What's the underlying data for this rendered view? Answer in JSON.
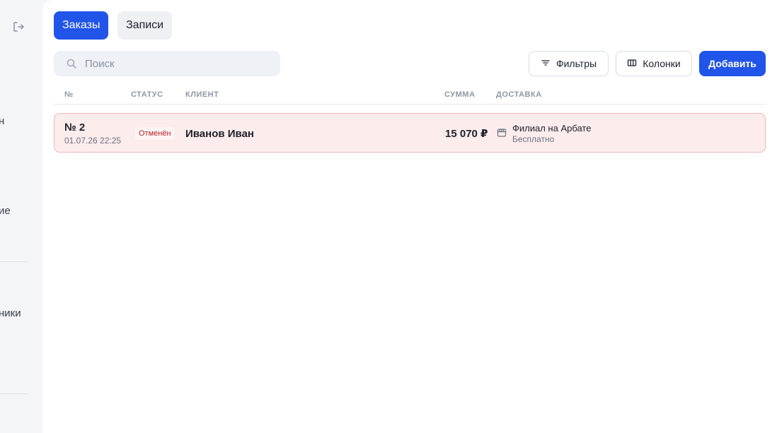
{
  "sidebar": {
    "labels": [
      "н",
      "ие",
      "ники"
    ]
  },
  "tabs": [
    {
      "label": "Заказы",
      "active": true
    },
    {
      "label": "Записи",
      "active": false
    }
  ],
  "search": {
    "placeholder": "Поиск",
    "value": ""
  },
  "toolbar": {
    "filters_label": "Фильтры",
    "columns_label": "Колонки",
    "add_label": "Добавить"
  },
  "table": {
    "columns": [
      "№",
      "СТАТУС",
      "КЛИЕНТ",
      "СУММА",
      "ДОСТАВКА"
    ],
    "rows": [
      {
        "number": "№ 2",
        "date": "01.07.26 22:25",
        "status": "Отменён",
        "client": "Иванов Иван",
        "amount": "15 070 ₽",
        "delivery_name": "Филиал на Арбате",
        "delivery_price": "Бесплатно"
      }
    ]
  },
  "colors": {
    "accent": "#2154e8",
    "row_cancelled_bg": "#fdecec",
    "row_cancelled_border": "#efb9bd",
    "status_cancelled_text": "#b4232a"
  },
  "icons": [
    "logout-icon",
    "search-icon",
    "filter-icon",
    "columns-icon",
    "store-icon"
  ]
}
